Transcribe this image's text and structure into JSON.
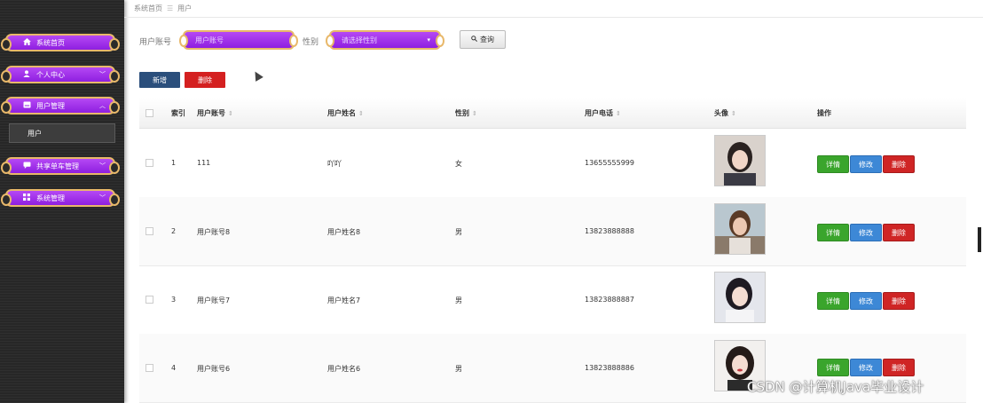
{
  "sidebar": {
    "items": [
      {
        "label": "系统首页",
        "icon": "home-icon"
      },
      {
        "label": "个人中心",
        "icon": "user-icon"
      },
      {
        "label": "用户管理",
        "icon": "user-card-icon"
      },
      {
        "label": "共享单车管理",
        "icon": "bike-icon"
      },
      {
        "label": "系统管理",
        "icon": "grid-icon"
      }
    ],
    "submenu": [
      {
        "label": "用户"
      }
    ]
  },
  "breadcrumb": {
    "home": "系统首页",
    "current": "用户"
  },
  "search": {
    "account_label": "用户账号",
    "account_placeholder": "用户账号",
    "gender_label": "性别",
    "gender_placeholder": "请选择性别",
    "button_label": "查询"
  },
  "toolbar": {
    "add_label": "新增",
    "delete_label": "删除"
  },
  "table": {
    "headers": {
      "index": "索引",
      "account": "用户账号",
      "name": "用户姓名",
      "gender": "性别",
      "phone": "用户电话",
      "avatar": "头像",
      "actions": "操作"
    },
    "rows": [
      {
        "index": "1",
        "account": "111",
        "name": "吖吖",
        "gender": "女",
        "phone": "13655555999"
      },
      {
        "index": "2",
        "account": "用户账号8",
        "name": "用户姓名8",
        "gender": "男",
        "phone": "13823888888"
      },
      {
        "index": "3",
        "account": "用户账号7",
        "name": "用户姓名7",
        "gender": "男",
        "phone": "13823888887"
      },
      {
        "index": "4",
        "account": "用户账号6",
        "name": "用户姓名6",
        "gender": "男",
        "phone": "13823888886"
      }
    ],
    "actions": {
      "detail": "详情",
      "edit": "修改",
      "delete": "删除"
    }
  },
  "watermark": "CSDN @计算机Java毕业设计",
  "colors": {
    "menu_purple": "#9b2de8",
    "menu_border": "#e8b86a",
    "add_btn": "#2b4f7c",
    "del_btn": "#d42020",
    "detail_btn": "#3aa52c",
    "edit_btn": "#3d88d6"
  }
}
